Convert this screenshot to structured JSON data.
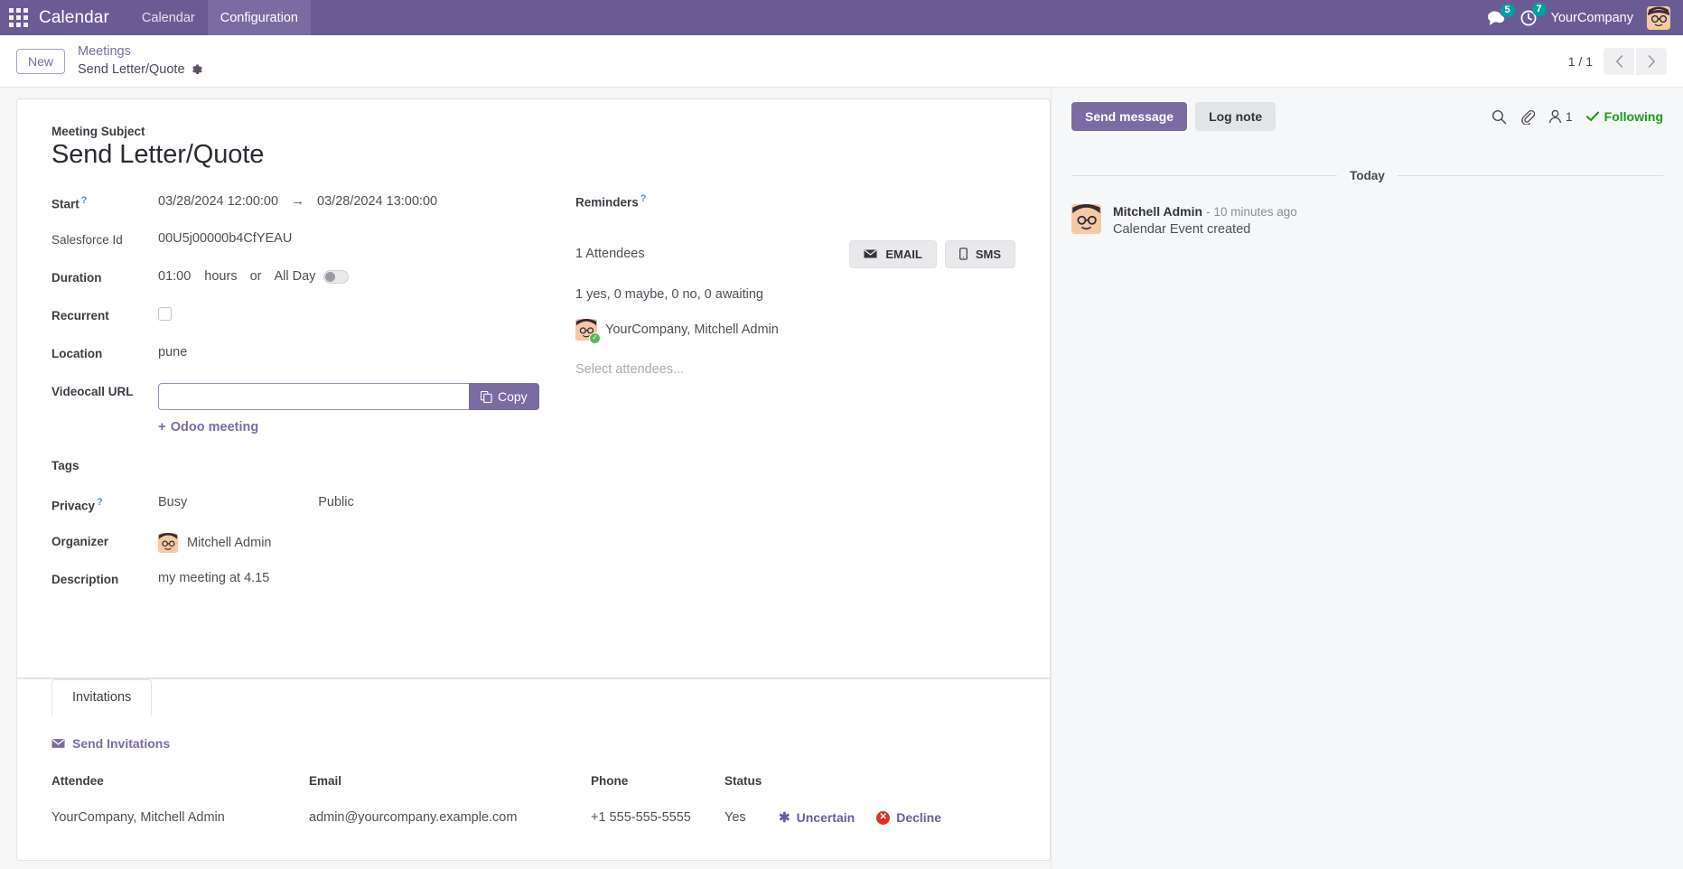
{
  "navbar": {
    "apps_icon": "apps-grid-icon",
    "brand": "Calendar",
    "menus": [
      {
        "label": "Calendar",
        "active": false
      },
      {
        "label": "Configuration",
        "active": true
      }
    ],
    "messages_icon": "chat-bubble-icon",
    "messages_count": "5",
    "activities_icon": "clock-icon",
    "activities_count": "7",
    "company": "YourCompany",
    "user_avatar": "user-avatar-icon",
    "accent_color": "#6b5b95",
    "badge_color": "#00a09d"
  },
  "control_panel": {
    "new_button": "New",
    "breadcrumb_parent": "Meetings",
    "breadcrumb_current": "Send Letter/Quote",
    "gear_icon": "gear-icon",
    "pager_count": "1 / 1",
    "prev_icon": "chevron-left-icon",
    "next_icon": "chevron-right-icon"
  },
  "form": {
    "subject_label": "Meeting Subject",
    "subject_value": "Send Letter/Quote",
    "fields": {
      "start_label": "Start",
      "start_value": "03/28/2024 12:00:00",
      "stop_value": "03/28/2024 13:00:00",
      "arrow": "→",
      "salesforce_label": "Salesforce Id",
      "salesforce_value": "00U5j00000b4CfYEAU",
      "duration_label": "Duration",
      "duration_value": "01:00",
      "duration_unit": "hours",
      "duration_or": "or",
      "allday_label": "All Day",
      "allday_on": false,
      "recurrent_label": "Recurrent",
      "recurrent_checked": false,
      "location_label": "Location",
      "location_value": "pune",
      "videocall_label": "Videocall URL",
      "videocall_value": "",
      "videocall_placeholder": "",
      "copy_button": "Copy",
      "copy_icon": "copy-icon",
      "odoo_meeting_link": "Odoo meeting",
      "tags_label": "Tags",
      "tags_value": "",
      "privacy_label": "Privacy",
      "privacy_show_as": "Busy",
      "privacy_visibility": "Public",
      "organizer_label": "Organizer",
      "organizer_value": "Mitchell Admin",
      "description_label": "Description",
      "description_value": "my meeting at 4.15"
    },
    "right": {
      "reminders_label": "Reminders",
      "reminders_value": "",
      "attendees_count": "1 Attendees",
      "email_button": "EMAIL",
      "email_icon": "envelope-icon",
      "sms_button": "SMS",
      "sms_icon": "mobile-icon",
      "attendee_summary": "1 yes, 0 maybe, 0 no, 0 awaiting",
      "attendee_name": "YourCompany, Mitchell Admin",
      "attendee_status_icon": "check-circle-icon",
      "select_placeholder": "Select attendees..."
    },
    "notebook": {
      "tabs": [
        {
          "label": "Invitations",
          "active": true
        }
      ],
      "send_invitations": "Send Invitations",
      "send_invitations_icon": "envelope-icon",
      "columns": [
        "Attendee",
        "Email",
        "Phone",
        "Status"
      ],
      "rows": [
        {
          "attendee": "YourCompany, Mitchell Admin",
          "email": "admin@yourcompany.example.com",
          "phone": "+1 555-555-5555",
          "status": "Yes",
          "action_uncertain": "Uncertain",
          "action_uncertain_icon": "asterisk-icon",
          "action_decline": "Decline",
          "action_decline_icon": "times-circle-icon"
        }
      ]
    }
  },
  "chatter": {
    "send_message_button": "Send message",
    "log_note_button": "Log note",
    "search_icon": "search-icon",
    "attachment_icon": "paperclip-icon",
    "followers_icon": "user-icon",
    "followers_count": "1",
    "following_label": "Following",
    "following_icon": "check-icon",
    "following_color": "#1a9c1a",
    "date_separator": "Today",
    "messages": [
      {
        "author": "Mitchell Admin",
        "time": "- 10 minutes ago",
        "body": "Calendar Event created",
        "avatar": "user-avatar-icon"
      }
    ]
  }
}
